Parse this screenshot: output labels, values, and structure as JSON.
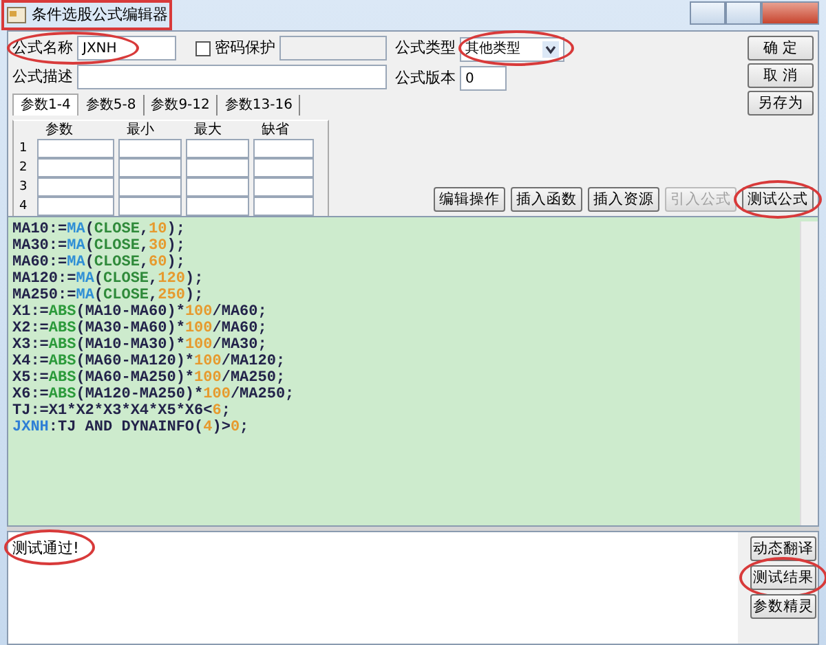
{
  "window": {
    "title": "条件选股公式编辑器",
    "boxed": true
  },
  "form": {
    "name_label": "公式名称",
    "name_value": "JXNH",
    "name_circled": true,
    "password": {
      "label": "密码保护",
      "checked": false
    },
    "desc_label": "公式描述",
    "type_label": "公式类型",
    "type_value": "其他类型",
    "type_circled": true,
    "version_label": "公式版本",
    "version_value": "0"
  },
  "side_buttons": [
    {
      "label": "确 定"
    },
    {
      "label": "取 消"
    },
    {
      "label": "另存为"
    }
  ],
  "param_tabs": [
    {
      "label": "参数1-4",
      "selected": true
    },
    {
      "label": "参数5-8",
      "selected": false
    },
    {
      "label": "参数9-12",
      "selected": false
    },
    {
      "label": "参数13-16",
      "selected": false
    }
  ],
  "param_table": {
    "columns": [
      "参数",
      "最小",
      "最大",
      "缺省"
    ],
    "rows": [
      "1",
      "2",
      "3",
      "4"
    ]
  },
  "tool_buttons": [
    {
      "label": "编辑操作",
      "disabled": false,
      "circled": false
    },
    {
      "label": "插入函数",
      "disabled": false,
      "circled": false
    },
    {
      "label": "插入资源",
      "disabled": false,
      "circled": false
    },
    {
      "label": "引入公式",
      "disabled": true,
      "circled": false
    },
    {
      "label": "测试公式",
      "disabled": false,
      "circled": true
    }
  ],
  "code_lines": [
    [
      {
        "kind": "plain",
        "t": "MA10:="
      },
      {
        "kind": "func",
        "t": "MA"
      },
      {
        "kind": "plain",
        "t": "("
      },
      {
        "kind": "const",
        "t": "CLOSE"
      },
      {
        "kind": "plain",
        "t": ","
      },
      {
        "kind": "num",
        "t": "10"
      },
      {
        "kind": "plain",
        "t": ");"
      }
    ],
    [
      {
        "kind": "plain",
        "t": "MA30:="
      },
      {
        "kind": "func",
        "t": "MA"
      },
      {
        "kind": "plain",
        "t": "("
      },
      {
        "kind": "const",
        "t": "CLOSE"
      },
      {
        "kind": "plain",
        "t": ","
      },
      {
        "kind": "num",
        "t": "30"
      },
      {
        "kind": "plain",
        "t": ");"
      }
    ],
    [
      {
        "kind": "plain",
        "t": "MA60:="
      },
      {
        "kind": "func",
        "t": "MA"
      },
      {
        "kind": "plain",
        "t": "("
      },
      {
        "kind": "const",
        "t": "CLOSE"
      },
      {
        "kind": "plain",
        "t": ","
      },
      {
        "kind": "num",
        "t": "60"
      },
      {
        "kind": "plain",
        "t": ");"
      }
    ],
    [
      {
        "kind": "plain",
        "t": "MA120:="
      },
      {
        "kind": "func",
        "t": "MA"
      },
      {
        "kind": "plain",
        "t": "("
      },
      {
        "kind": "const",
        "t": "CLOSE"
      },
      {
        "kind": "plain",
        "t": ","
      },
      {
        "kind": "num",
        "t": "120"
      },
      {
        "kind": "plain",
        "t": ");"
      }
    ],
    [
      {
        "kind": "plain",
        "t": "MA250:="
      },
      {
        "kind": "func",
        "t": "MA"
      },
      {
        "kind": "plain",
        "t": "("
      },
      {
        "kind": "const",
        "t": "CLOSE"
      },
      {
        "kind": "plain",
        "t": ","
      },
      {
        "kind": "num",
        "t": "250"
      },
      {
        "kind": "plain",
        "t": ");"
      }
    ],
    [
      {
        "kind": "plain",
        "t": "X1:="
      },
      {
        "kind": "math",
        "t": "ABS"
      },
      {
        "kind": "plain",
        "t": "(MA10-MA60)*"
      },
      {
        "kind": "num",
        "t": "100"
      },
      {
        "kind": "plain",
        "t": "/MA60;"
      }
    ],
    [
      {
        "kind": "plain",
        "t": "X2:="
      },
      {
        "kind": "math",
        "t": "ABS"
      },
      {
        "kind": "plain",
        "t": "(MA30-MA60)*"
      },
      {
        "kind": "num",
        "t": "100"
      },
      {
        "kind": "plain",
        "t": "/MA60;"
      }
    ],
    [
      {
        "kind": "plain",
        "t": "X3:="
      },
      {
        "kind": "math",
        "t": "ABS"
      },
      {
        "kind": "plain",
        "t": "(MA10-MA30)*"
      },
      {
        "kind": "num",
        "t": "100"
      },
      {
        "kind": "plain",
        "t": "/MA30;"
      }
    ],
    [
      {
        "kind": "plain",
        "t": "X4:="
      },
      {
        "kind": "math",
        "t": "ABS"
      },
      {
        "kind": "plain",
        "t": "(MA60-MA120)*"
      },
      {
        "kind": "num",
        "t": "100"
      },
      {
        "kind": "plain",
        "t": "/MA120;"
      }
    ],
    [
      {
        "kind": "plain",
        "t": "X5:="
      },
      {
        "kind": "math",
        "t": "ABS"
      },
      {
        "kind": "plain",
        "t": "(MA60-MA250)*"
      },
      {
        "kind": "num",
        "t": "100"
      },
      {
        "kind": "plain",
        "t": "/MA250;"
      }
    ],
    [
      {
        "kind": "plain",
        "t": "X6:="
      },
      {
        "kind": "math",
        "t": "ABS"
      },
      {
        "kind": "plain",
        "t": "(MA120-MA250)*"
      },
      {
        "kind": "num",
        "t": "100"
      },
      {
        "kind": "plain",
        "t": "/MA250;"
      }
    ],
    [
      {
        "kind": "plain",
        "t": "TJ:=X1*X2*X3*X4*X5*X6<"
      },
      {
        "kind": "num",
        "t": "6"
      },
      {
        "kind": "plain",
        "t": ";"
      }
    ],
    [
      {
        "kind": "output",
        "t": "JXNH"
      },
      {
        "kind": "plain",
        "t": ":TJ AND DYNAINFO("
      },
      {
        "kind": "num",
        "t": "4"
      },
      {
        "kind": "plain",
        "t": ")>"
      },
      {
        "kind": "num",
        "t": "0"
      },
      {
        "kind": "plain",
        "t": ";"
      }
    ]
  ],
  "output": {
    "text": "测试通过!",
    "circled": true
  },
  "output_buttons": [
    {
      "label": "动态翻译",
      "circled": false
    },
    {
      "label": "测试结果",
      "circled": true
    },
    {
      "label": "参数精灵",
      "circled": false
    }
  ]
}
